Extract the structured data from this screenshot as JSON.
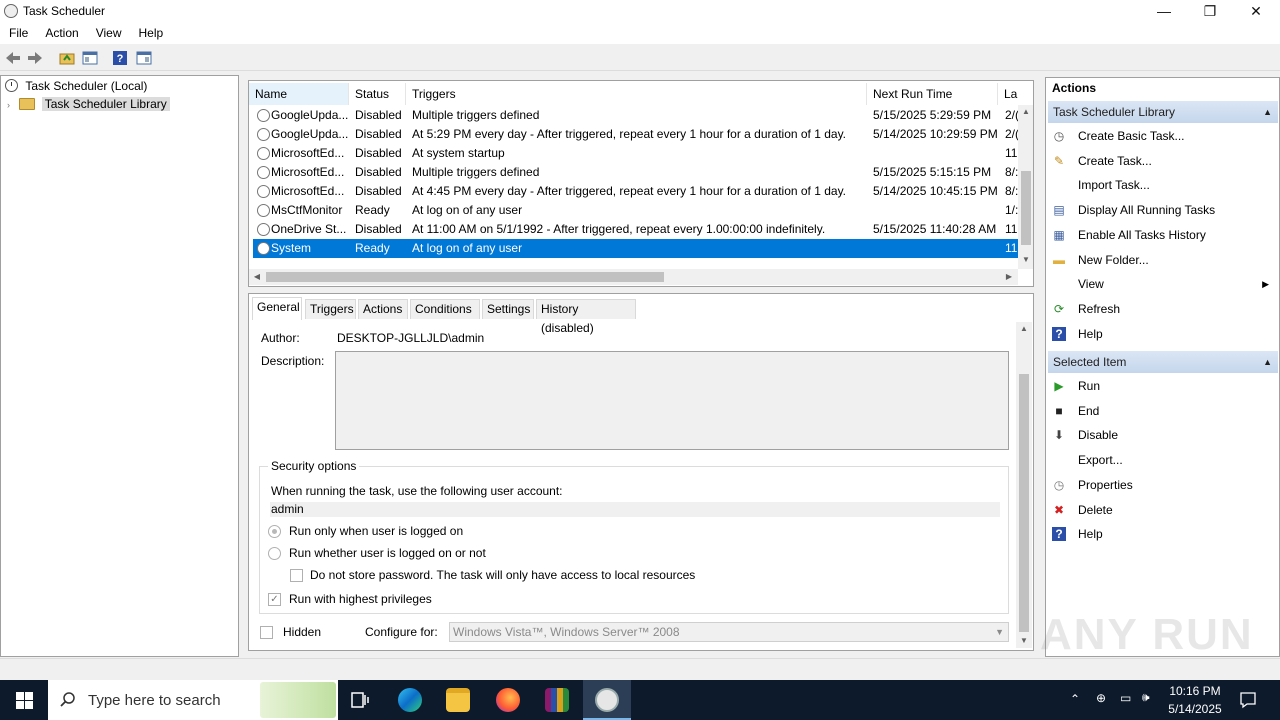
{
  "window": {
    "title": "Task Scheduler",
    "controls": {
      "minimize": "—",
      "restore": "❐",
      "close": "✕"
    }
  },
  "menu": [
    "File",
    "Action",
    "View",
    "Help"
  ],
  "tree": {
    "root": "Task Scheduler (Local)",
    "library": "Task Scheduler Library"
  },
  "tasklist": {
    "columns": [
      "Name",
      "Status",
      "Triggers",
      "Next Run Time",
      "La"
    ],
    "rows": [
      {
        "name": "GoogleUpda...",
        "status": "Disabled",
        "triggers": "Multiple triggers defined",
        "next_run": "5/15/2025 5:29:59 PM",
        "last": "2/(",
        "selected": false
      },
      {
        "name": "GoogleUpda...",
        "status": "Disabled",
        "triggers": "At 5:29 PM every day - After triggered, repeat every 1 hour for a duration of 1 day.",
        "next_run": "5/14/2025 10:29:59 PM",
        "last": "2/(",
        "selected": false
      },
      {
        "name": "MicrosoftEd...",
        "status": "Disabled",
        "triggers": "At system startup",
        "next_run": "",
        "last": "11.",
        "selected": false
      },
      {
        "name": "MicrosoftEd...",
        "status": "Disabled",
        "triggers": "Multiple triggers defined",
        "next_run": "5/15/2025 5:15:15 PM",
        "last": "8/:",
        "selected": false
      },
      {
        "name": "MicrosoftEd...",
        "status": "Disabled",
        "triggers": "At 4:45 PM every day - After triggered, repeat every 1 hour for a duration of 1 day.",
        "next_run": "5/14/2025 10:45:15 PM",
        "last": "8/:",
        "selected": false
      },
      {
        "name": "MsCtfMonitor",
        "status": "Ready",
        "triggers": "At log on of any user",
        "next_run": "",
        "last": "1/:",
        "selected": false
      },
      {
        "name": "OneDrive St...",
        "status": "Disabled",
        "triggers": "At 11:00 AM on 5/1/1992 - After triggered, repeat every 1.00:00:00 indefinitely.",
        "next_run": "5/15/2025 11:40:28 AM",
        "last": "11.",
        "selected": false
      },
      {
        "name": "System",
        "status": "Ready",
        "triggers": "At log on of any user",
        "next_run": "",
        "last": "11.",
        "selected": true
      }
    ]
  },
  "detail": {
    "tabs": [
      "General",
      "Triggers",
      "Actions",
      "Conditions",
      "Settings",
      "History (disabled)"
    ],
    "author_label": "Author:",
    "author_value": "DESKTOP-JGLLJLD\\admin",
    "description_label": "Description:",
    "security": {
      "legend": "Security options",
      "account_prompt": "When running the task, use the following user account:",
      "account": "admin",
      "opt_logged_on": "Run only when user is logged on",
      "opt_whether": "Run whether user is logged on or not",
      "opt_no_password": "Do not store password.  The task will only have access to local resources",
      "opt_highest": "Run with highest privileges"
    },
    "hidden_label": "Hidden",
    "configure_label": "Configure for:",
    "configure_value": "Windows Vista™, Windows Server™ 2008"
  },
  "actions": {
    "header": "Actions",
    "library_section": "Task Scheduler Library",
    "library_items": [
      {
        "label": "Create Basic Task...",
        "icon": "create-basic-task-icon"
      },
      {
        "label": "Create Task...",
        "icon": "create-task-icon"
      },
      {
        "label": "Import Task...",
        "icon": ""
      },
      {
        "label": "Display All Running Tasks",
        "icon": "running-tasks-icon"
      },
      {
        "label": "Enable All Tasks History",
        "icon": "history-icon"
      },
      {
        "label": "New Folder...",
        "icon": "folder-icon"
      },
      {
        "label": "View",
        "icon": ""
      },
      {
        "label": "Refresh",
        "icon": "refresh-icon"
      },
      {
        "label": "Help",
        "icon": "help-icon"
      }
    ],
    "selected_section": "Selected Item",
    "selected_items": [
      {
        "label": "Run",
        "icon": "run-icon"
      },
      {
        "label": "End",
        "icon": "end-icon"
      },
      {
        "label": "Disable",
        "icon": "disable-icon"
      },
      {
        "label": "Export...",
        "icon": ""
      },
      {
        "label": "Properties",
        "icon": "properties-icon"
      },
      {
        "label": "Delete",
        "icon": "delete-icon"
      },
      {
        "label": "Help",
        "icon": "help-icon"
      }
    ]
  },
  "taskbar": {
    "search_placeholder": "Type here to search",
    "time": "10:16 PM",
    "date": "5/14/2025"
  },
  "watermark": "ANY RUN",
  "colors": {
    "selection": "#0078d7",
    "taskbar": "#0d1a2b",
    "section_header": "#c5d6ec"
  }
}
